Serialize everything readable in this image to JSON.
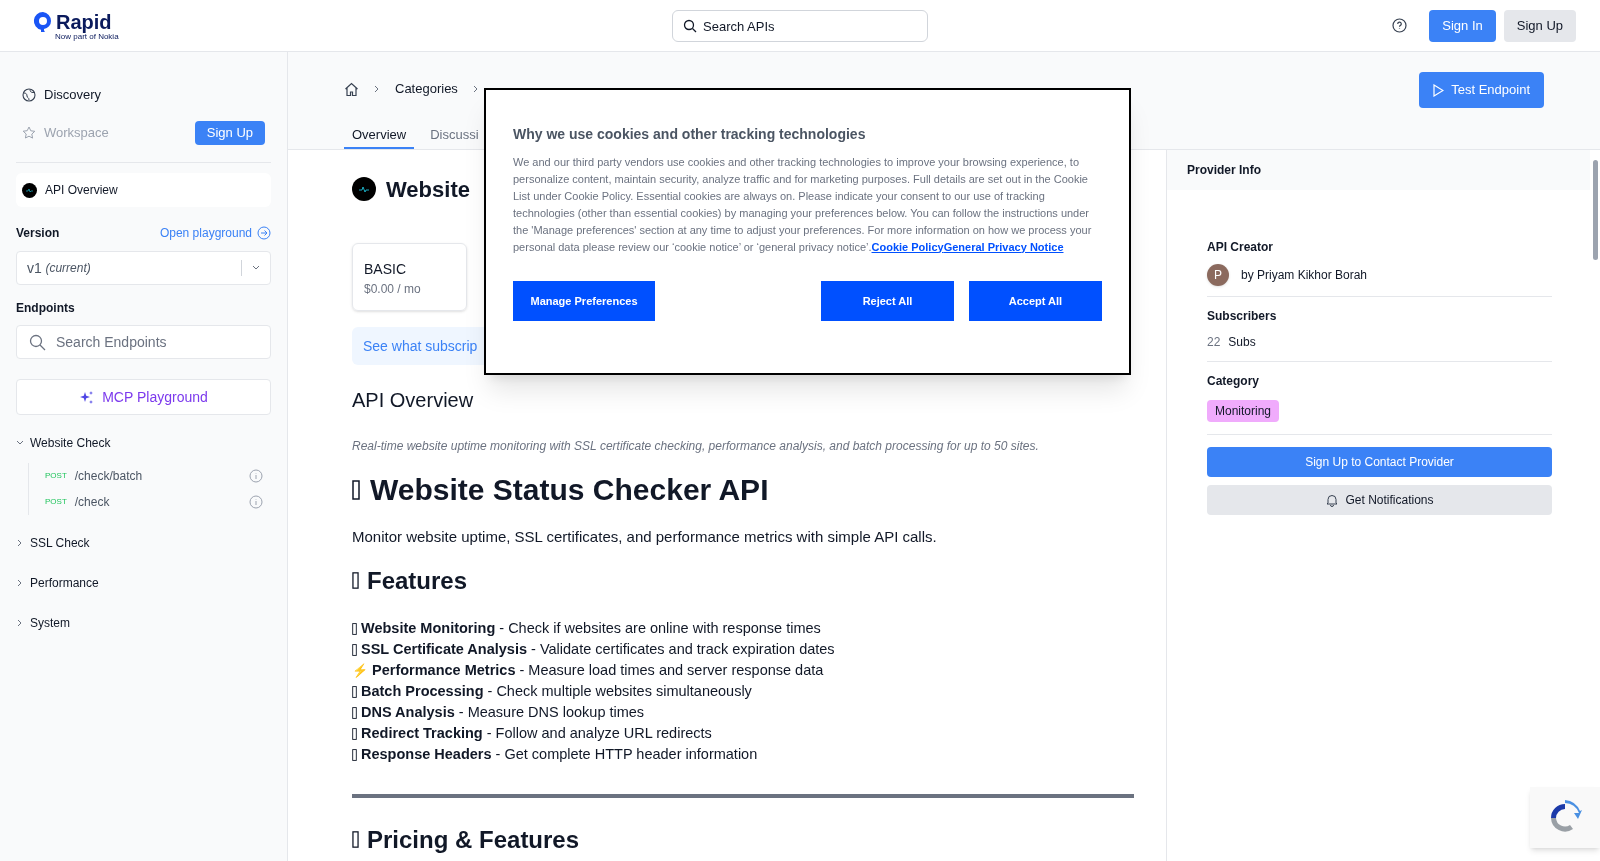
{
  "header": {
    "logo": {
      "name": "Rapid",
      "tagline": "Now part of Nokia"
    },
    "search": {
      "placeholder": "Search APIs"
    },
    "buttons": [
      {
        "label": "Sign In",
        "kind": "primary"
      },
      {
        "label": "Sign Up",
        "kind": "secondary"
      }
    ]
  },
  "sidebar": {
    "nav": [
      {
        "label": "Discovery",
        "disabled": false
      },
      {
        "label": "Workspace",
        "disabled": true
      }
    ],
    "signup_button": "Sign Up",
    "api_overview": {
      "label": "API Overview"
    },
    "version": {
      "label": "Version",
      "link": "Open playground",
      "value": "v1",
      "note": "(current)"
    },
    "endpoints": {
      "label": "Endpoints",
      "search": {
        "placeholder": "Search Endpoints"
      },
      "mcp_button": "MCP Playground",
      "groups": [
        {
          "label": "Website Check",
          "expanded": true,
          "children": [
            {
              "method": "POST",
              "path": "/check/batch"
            },
            {
              "method": "POST",
              "path": "/check"
            }
          ]
        },
        {
          "label": "SSL Check",
          "expanded": false
        },
        {
          "label": "Performance",
          "expanded": false
        },
        {
          "label": "System",
          "expanded": false
        }
      ]
    }
  },
  "main": {
    "breadcrumb": [
      "Categories"
    ],
    "test_button": "Test Endpoint",
    "tabs": [
      {
        "label": "Overview",
        "selected": true
      },
      {
        "label": "Discussi",
        "selected": false
      }
    ],
    "title": "Website",
    "plan": {
      "name": "BASIC",
      "price": "$0.00 / mo"
    },
    "subscriptions_link": "See what subscrip",
    "overview_heading": "API Overview",
    "description": "Real-time website uptime monitoring with SSL certificate checking, performance analysis, and batch processing for up to 50 sites.",
    "content": [
      {
        "kind": "h1",
        "text": "Website Status Checker API"
      },
      {
        "kind": "p",
        "text": "Monitor website uptime, SSL certificates, and performance metrics with simple API calls."
      },
      {
        "kind": "h2",
        "text": "Features"
      },
      {
        "kind": "list",
        "items": [
          {
            "text": "**Website Monitoring** - Check if websites are online with response times"
          },
          {
            "text": "**SSL Certificate Analysis** - Validate certificates and track expiration dates"
          },
          {
            "marker": "⚡",
            "text": "**Performance Metrics** - Measure load times and server response data"
          },
          {
            "text": "**Batch Processing** - Check multiple websites simultaneously"
          },
          {
            "text": "**DNS Analysis** - Measure DNS lookup times"
          },
          {
            "text": "**Redirect Tracking** - Follow and analyze URL redirects"
          },
          {
            "text": "**Response Headers** - Get complete HTTP header information"
          }
        ]
      },
      {
        "kind": "rule"
      },
      {
        "kind": "h2",
        "text": "Pricing & Features"
      }
    ]
  },
  "cookie_dialog": {
    "title": "Why we use cookies and other tracking technologies",
    "body": "We and our third party vendors use cookies and other tracking technologies to improve your browsing experience, to personalize content, maintain security, analyze traffic and for marketing purposes. Full details are set out in the Cookie List under Cookie Policy. Essential cookies are always on. Please indicate your consent to our use of tracking technologies (other than essential cookies) by managing your preferences below. You can follow the instructions under the 'Manage preferences' section at any time to adjust your preferences. For more information on how we process your personal data please review our ‘cookie notice’ or ‘general privacy notice’.",
    "links": [
      "Cookie Policy",
      "General Privacy Notice"
    ],
    "buttons": [
      "Manage Preferences",
      "Reject All",
      "Accept All"
    ]
  },
  "provider": {
    "title": "Provider Info",
    "creator": {
      "label": "API Creator",
      "avatar": "P",
      "name": "by Priyam Kikhor Borah"
    },
    "subscribers": {
      "label": "Subscribers",
      "count": "22",
      "unit": "Subs"
    },
    "category": {
      "label": "Category",
      "tag": "Monitoring"
    },
    "contact_button": "Sign Up to Contact Provider",
    "notify_button": "Get Notifications"
  }
}
